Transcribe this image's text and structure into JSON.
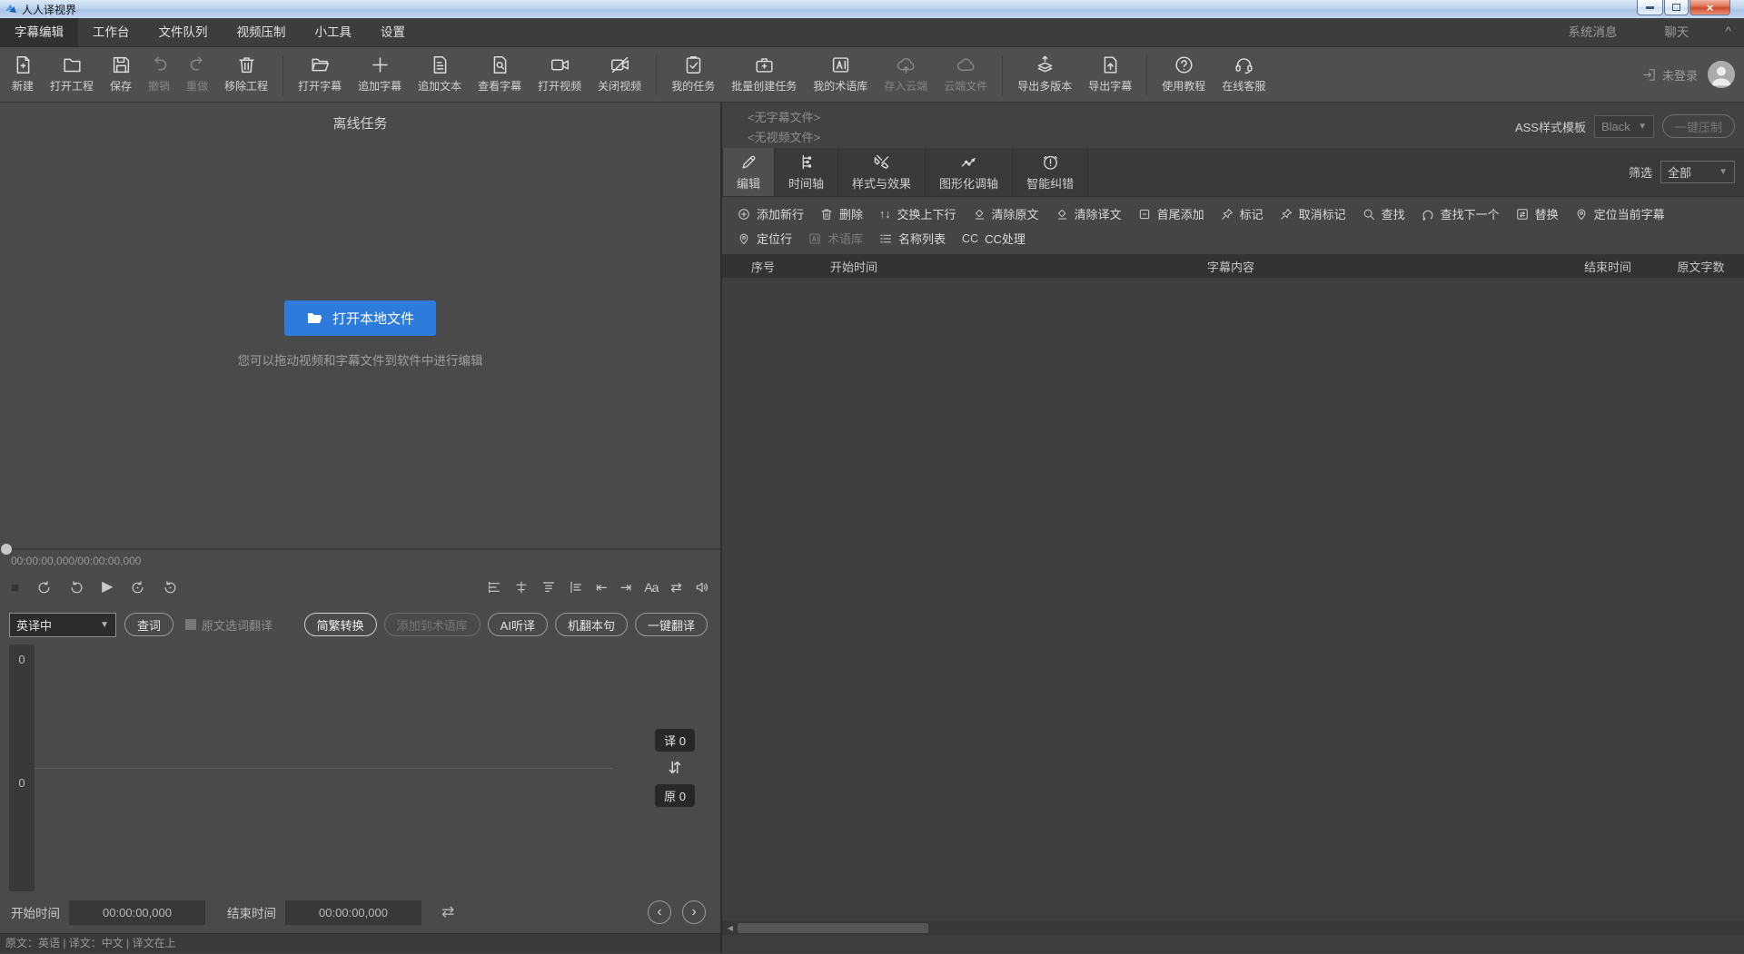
{
  "window": {
    "title": "人人译视界",
    "close_glyph": "×"
  },
  "colors": {
    "accent_blue": "#2d7bdb",
    "titlebar_blue": "#bcd2ec",
    "close_red": "#cf4b2b",
    "panel_dark": "#4a4a4a"
  },
  "menu": {
    "items": [
      {
        "label": "字幕编辑",
        "active": true
      },
      {
        "label": "工作台"
      },
      {
        "label": "文件队列"
      },
      {
        "label": "视频压制"
      },
      {
        "label": "小工具"
      },
      {
        "label": "设置"
      }
    ],
    "right_items": [
      {
        "label": "系统消息"
      },
      {
        "label": "聊天"
      }
    ],
    "collapse_glyph": "^"
  },
  "toolbar": {
    "items": [
      {
        "label": "新建",
        "icon": "s-doc-plus"
      },
      {
        "label": "打开工程",
        "icon": "s-folder"
      },
      {
        "label": "保存",
        "icon": "s-save"
      },
      {
        "label": "撤销",
        "icon": "s-undo",
        "disabled": true
      },
      {
        "label": "重做",
        "icon": "s-redo",
        "disabled": true
      },
      {
        "label": "移除工程",
        "icon": "s-trash"
      },
      {
        "sep": true
      },
      {
        "label": "打开字幕",
        "icon": "s-folder-open"
      },
      {
        "label": "追加字幕",
        "icon": "s-plus"
      },
      {
        "label": "追加文本",
        "icon": "s-doc-text"
      },
      {
        "label": "查看字幕",
        "icon": "s-doc-search"
      },
      {
        "label": "打开视频",
        "icon": "s-video"
      },
      {
        "label": "关闭视频",
        "icon": "s-video-off"
      },
      {
        "sep": true
      },
      {
        "label": "我的任务",
        "icon": "s-tasks"
      },
      {
        "label": "批量创建任务",
        "icon": "s-case-plus"
      },
      {
        "label": "我的术语库",
        "icon": "s-termbase"
      },
      {
        "label": "存入云端",
        "icon": "s-cloud-up",
        "disabled": true
      },
      {
        "label": "云端文件",
        "icon": "s-cloud",
        "disabled": true
      },
      {
        "sep": true
      },
      {
        "label": "导出多版本",
        "icon": "s-layers-up"
      },
      {
        "label": "导出字幕",
        "icon": "s-doc-up"
      },
      {
        "sep": true
      },
      {
        "label": "使用教程",
        "icon": "s-help"
      },
      {
        "label": "在线客服",
        "icon": "s-headset"
      }
    ],
    "login_label": "未登录"
  },
  "left_panel": {
    "header": "离线任务",
    "open_button_label": "打开本地文件",
    "hint": "您可以拖动视频和字幕文件到软件中进行编辑",
    "timecode": "00:00:00,000/00:00:00,000",
    "playbar": {
      "stop_glyph": "■",
      "play_glyph": "▶",
      "to_start_glyph": "⇤",
      "to_end_glyph": "⇥",
      "font_glyph": "Aa",
      "swap_glyph": "⇄"
    },
    "translate": {
      "direction_value": "英译中",
      "caret_glyph": "▼",
      "lookup_label": "查词",
      "select_translate_label": "原文选词翻译",
      "buttons": [
        {
          "label": "简繁转换",
          "bright": true
        },
        {
          "label": "添加到术语库",
          "disabled": true
        },
        {
          "label": "AI听译"
        },
        {
          "label": "机翻本句"
        },
        {
          "label": "一键翻译"
        }
      ]
    },
    "editor": {
      "translation_line_count": "0",
      "original_line_count": "0",
      "translation_badge": "译 0",
      "swap_glyph": "⇵",
      "original_badge": "原 0"
    },
    "time_row": {
      "start_label": "开始时间",
      "start_value": "00:00:00,000",
      "end_label": "结束时间",
      "end_value": "00:00:00,000",
      "swap_glyph": "⇄",
      "prev_glyph": "‹",
      "next_glyph": "›"
    },
    "status_text": "原文：英语 | 译文：中文 | 译文在上"
  },
  "right_panel": {
    "subtitle_file_placeholder": "<无字幕文件>",
    "video_file_placeholder": "<无视频文件>",
    "ass_template_label": "ASS样式模板",
    "ass_template_value": "Black",
    "caret_glyph": "▼",
    "compress_button_label": "一键压制",
    "tabs": [
      {
        "label": "编辑",
        "icon": "s-pencil",
        "active": true
      },
      {
        "label": "时间轴",
        "icon": "s-sliders"
      },
      {
        "label": "样式与效果",
        "icon": "s-tools"
      },
      {
        "label": "图形化调轴",
        "icon": "s-graph"
      },
      {
        "label": "智能纠错",
        "icon": "s-alarm"
      }
    ],
    "filter_label": "筛选",
    "filter_value": "全部",
    "edit_tools_row1": [
      {
        "label": "添加新行",
        "icon": "s-plus-circle"
      },
      {
        "label": "删除",
        "icon": "s-trash"
      },
      {
        "label": "交换上下行",
        "glyph": "↑↓"
      },
      {
        "label": "清除原文",
        "icon": "s-eraser"
      },
      {
        "label": "清除译文",
        "icon": "s-eraser"
      },
      {
        "label": "首尾添加",
        "icon": "s-bracket-add"
      },
      {
        "label": "标记",
        "icon": "s-pin"
      },
      {
        "label": "取消标记",
        "icon": "s-pin"
      },
      {
        "label": "查找",
        "icon": "s-search"
      },
      {
        "label": "查找下一个",
        "icon": "s-search-next"
      },
      {
        "label": "替换",
        "icon": "s-replace"
      },
      {
        "label": "定位当前字幕",
        "icon": "s-locate"
      }
    ],
    "edit_tools_row2": [
      {
        "label": "定位行",
        "icon": "s-locate"
      },
      {
        "label": "术语库",
        "icon": "s-termbase",
        "disabled": true
      },
      {
        "label": "名称列表",
        "icon": "s-list"
      },
      {
        "label": "CC处理",
        "glyph": "CC"
      }
    ],
    "table_headers": [
      "序号",
      "开始时间",
      "字幕内容",
      "结束时间",
      "原文字数"
    ],
    "scrollbar_left_glyph": "◀"
  }
}
